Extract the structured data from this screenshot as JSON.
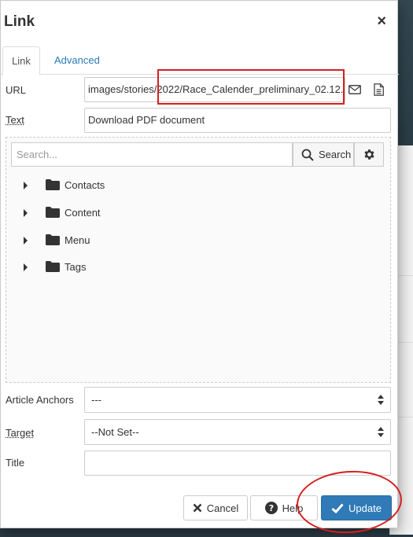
{
  "dialog": {
    "title": "Link",
    "close_symbol": "×"
  },
  "tabs": [
    {
      "label": "Link",
      "active": true
    },
    {
      "label": "Advanced",
      "active": false
    }
  ],
  "url": {
    "label": "URL",
    "value": "images/stories/2022/Race_Calender_preliminary_02.12...."
  },
  "text": {
    "label": "Text",
    "value": "Download PDF document"
  },
  "browser": {
    "search_placeholder": "Search...",
    "search_button": "Search",
    "items": [
      {
        "label": "Contacts"
      },
      {
        "label": "Content"
      },
      {
        "label": "Menu"
      },
      {
        "label": "Tags"
      }
    ]
  },
  "article_anchors": {
    "label": "Article Anchors",
    "value": "---"
  },
  "target": {
    "label": "Target",
    "value": "--Not Set--"
  },
  "title_field": {
    "label": "Title",
    "value": ""
  },
  "buttons": {
    "cancel": "Cancel",
    "help": "Help",
    "update": "Update"
  },
  "colors": {
    "primary": "#2f7ab7",
    "link": "#2a7ab8",
    "annotation": "#d42020"
  }
}
